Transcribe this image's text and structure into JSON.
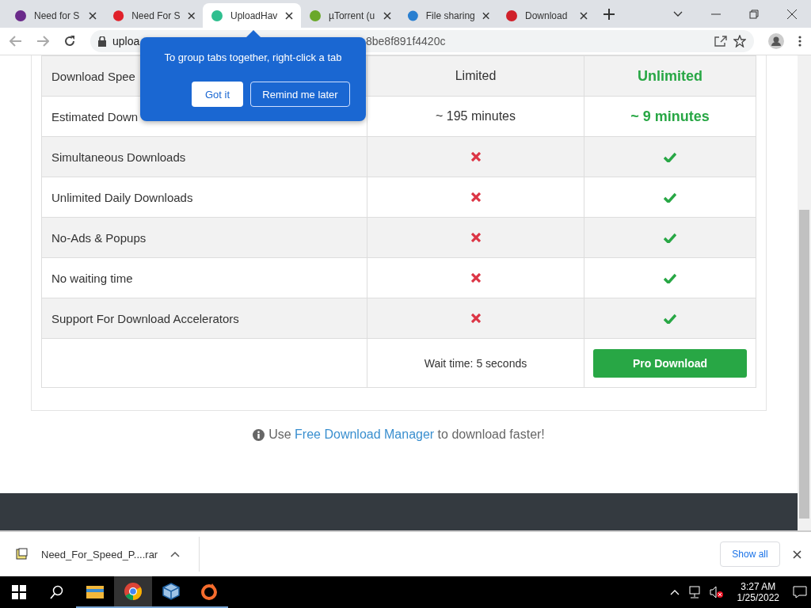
{
  "tabs": [
    {
      "title": "Need for S",
      "selected": false
    },
    {
      "title": "Need For S",
      "selected": false
    },
    {
      "title": "UploadHav",
      "selected": true
    },
    {
      "title": "µTorrent (u",
      "selected": false
    },
    {
      "title": "File sharing",
      "selected": false
    },
    {
      "title": "Download",
      "selected": false
    }
  ],
  "address_bar": {
    "url_start": "uploa",
    "url_end": "8be8f891f4420c"
  },
  "popup": {
    "message": "To group tabs together, right-click a tab",
    "buttons": [
      "Got it",
      "Remind me later"
    ]
  },
  "table": {
    "rows": [
      {
        "kind": "text",
        "feature": "Download Spee",
        "limited": "Limited",
        "unlimited": "Unlimited"
      },
      {
        "kind": "text",
        "feature": "Estimated Down",
        "limited": "~ 195 minutes",
        "unlimited": "~ 9 minutes"
      },
      {
        "kind": "availability",
        "feature": "Simultaneous Downloads",
        "limited": false,
        "unlimited": true
      },
      {
        "kind": "availability",
        "feature": "Unlimited Daily Downloads",
        "limited": false,
        "unlimited": true
      },
      {
        "kind": "availability",
        "feature": "No-Ads & Popups",
        "limited": false,
        "unlimited": true
      },
      {
        "kind": "availability",
        "feature": "No waiting time",
        "limited": false,
        "unlimited": true
      },
      {
        "kind": "availability",
        "feature": "Support For Download Accelerators",
        "limited": false,
        "unlimited": true
      }
    ],
    "wait_text": "Wait time: 5 seconds",
    "pro_button": "Pro Download"
  },
  "note": {
    "before": "Use",
    "link": "Free Download Manager",
    "after": "to download faster!"
  },
  "download_bar": {
    "file": "Need_For_Speed_P....rar",
    "show_all": "Show all"
  },
  "taskbar": {
    "time": "3:27 AM",
    "date": "1/25/2022"
  }
}
